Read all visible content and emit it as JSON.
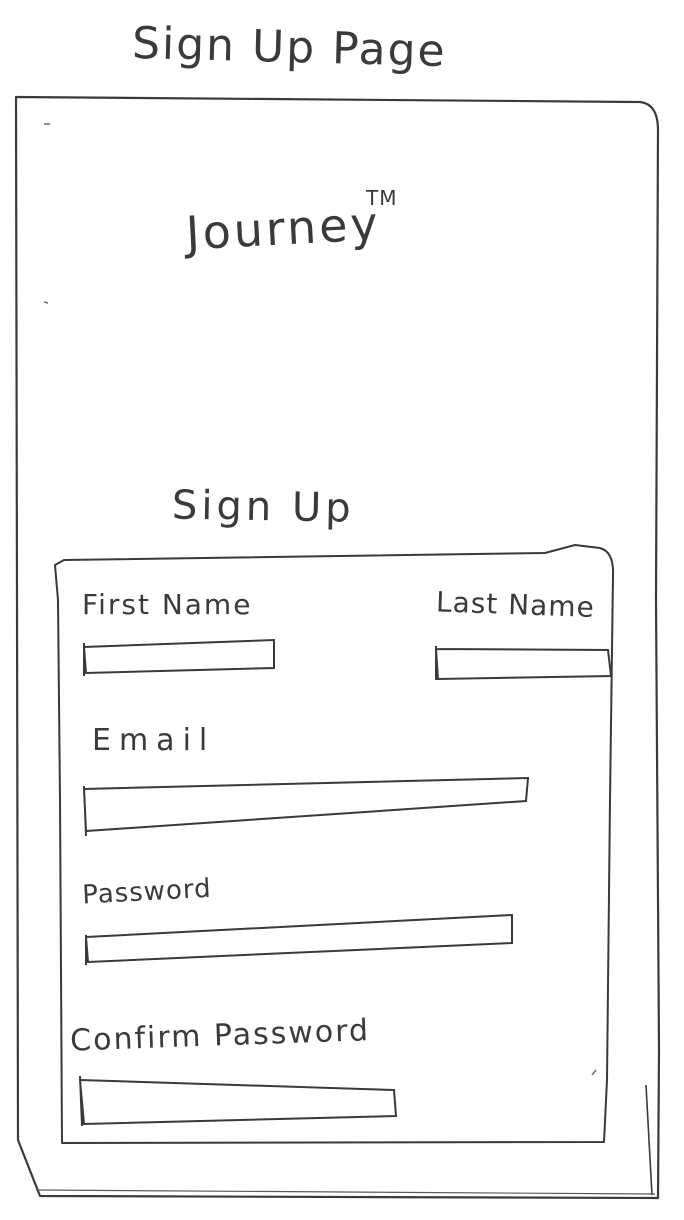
{
  "sketch_title": "Sign Up Page",
  "app": {
    "brand": "Journey",
    "trademark": "TM"
  },
  "form": {
    "heading": "Sign Up",
    "fields": {
      "first_name": "First Name",
      "last_name": "Last Name",
      "email": "Email",
      "password": "Password",
      "confirm_password": "Confirm Password"
    }
  }
}
